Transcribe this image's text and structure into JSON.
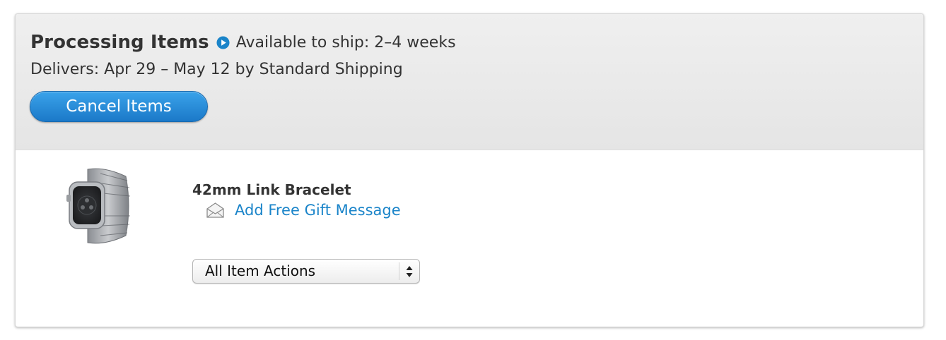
{
  "header": {
    "title": "Processing Items",
    "availability_icon": "play-circle-icon",
    "availability": "Available to ship: 2–4 weeks",
    "delivers": "Delivers: Apr 29 – May 12 by Standard Shipping",
    "cancel_label": "Cancel Items"
  },
  "item": {
    "image_icon": "apple-watch-link-bracelet-image",
    "name": "42mm Link Bracelet",
    "gift_icon": "envelope-icon",
    "gift_label": "Add Free Gift Message",
    "actions_select": {
      "selected": "All Item Actions",
      "icon": "up-down-arrows-icon"
    }
  },
  "colors": {
    "accent_blue": "#1a84c9",
    "button_blue": "#2a8bd8",
    "header_bg": "#e9e9e9",
    "text": "#333333"
  }
}
